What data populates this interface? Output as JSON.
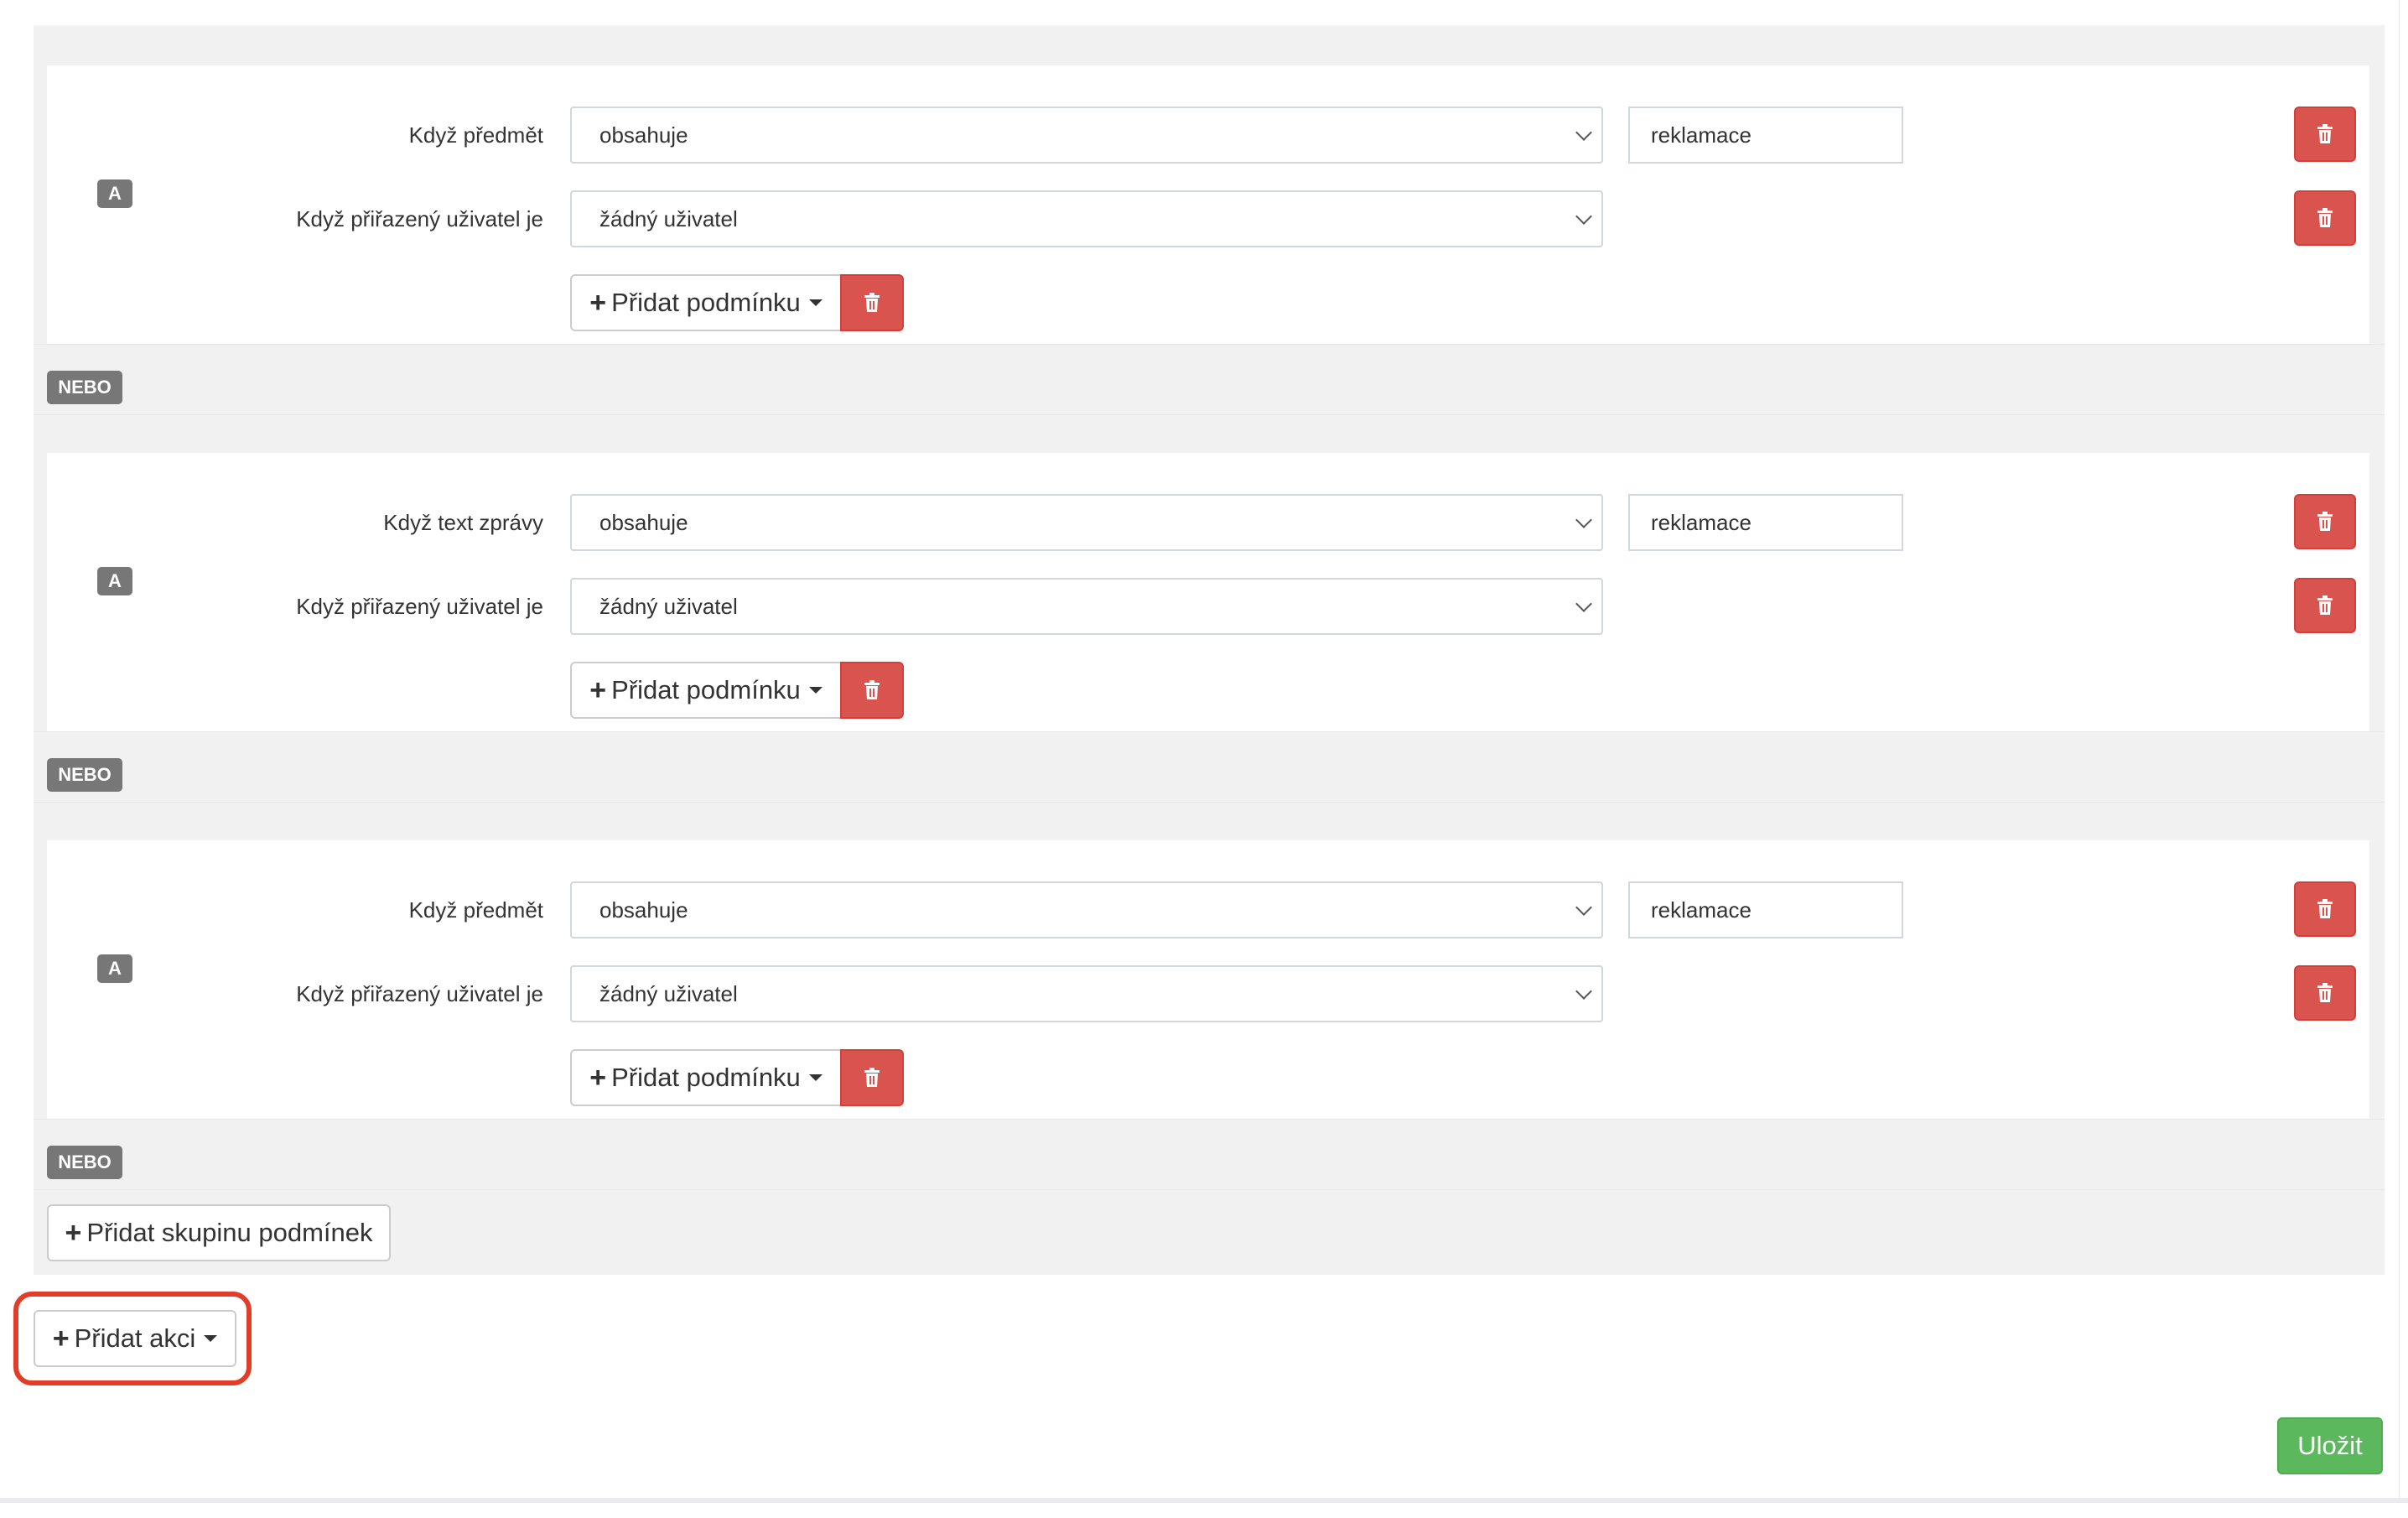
{
  "groups": [
    {
      "tag": "A",
      "conditions": [
        {
          "label": "Když předmět",
          "operator": "obsahuje",
          "value": "reklamace"
        },
        {
          "label": "Když přiřazený uživatel je",
          "operator": "žádný uživatel"
        }
      ],
      "add_condition_label": "Přidat podmínku",
      "separator": "NEBO"
    },
    {
      "tag": "A",
      "conditions": [
        {
          "label": "Když text zprávy",
          "operator": "obsahuje",
          "value": "reklamace"
        },
        {
          "label": "Když přiřazený uživatel je",
          "operator": "žádný uživatel"
        }
      ],
      "add_condition_label": "Přidat podmínku",
      "separator": "NEBO"
    },
    {
      "tag": "A",
      "conditions": [
        {
          "label": "Když předmět",
          "operator": "obsahuje",
          "value": "reklamace"
        },
        {
          "label": "Když přiřazený uživatel je",
          "operator": "žádný uživatel"
        }
      ],
      "add_condition_label": "Přidat podmínku",
      "separator": "NEBO"
    }
  ],
  "add_group_label": "Přidat skupinu podmínek",
  "add_action_label": "Přidat akci",
  "save_label": "Uložit",
  "icons": {
    "plus": "plus-icon",
    "trash": "trash-icon",
    "caret": "caret-down-icon",
    "chevron": "chevron-down-icon"
  },
  "colors": {
    "danger": "#d9534f",
    "success": "#5cb85c",
    "highlight": "#e23d28",
    "tag": "#777777"
  }
}
